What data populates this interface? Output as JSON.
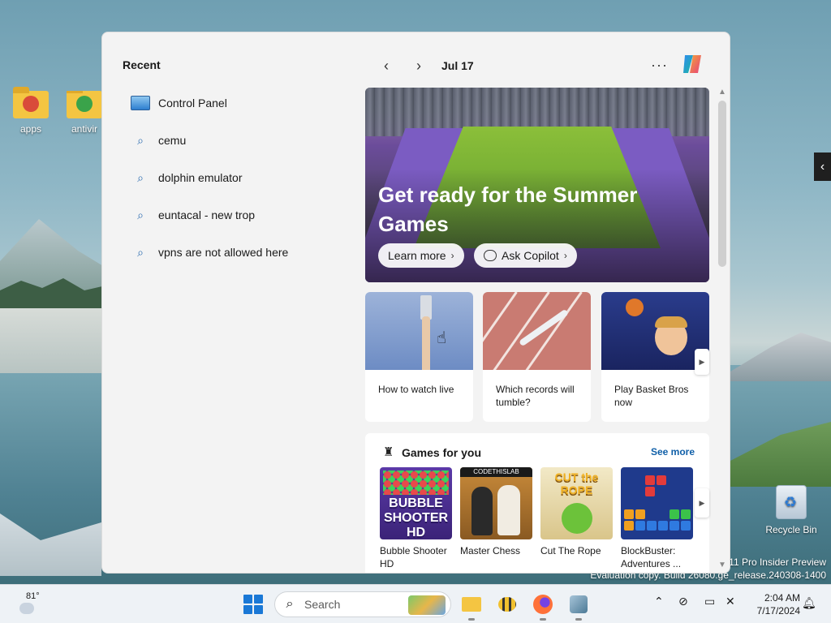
{
  "desktop": {
    "icons": [
      {
        "label": "apps"
      },
      {
        "label": "antivir"
      },
      {
        "label": "Recycle Bin"
      }
    ],
    "watermark_line1": "s 11 Pro Insider Preview",
    "watermark_line2": "Evaluation copy. Build 26080.ge_release.240308-1400"
  },
  "panel": {
    "recent_title": "Recent",
    "recent_items": [
      {
        "label": "Control Panel",
        "icon": "control-panel-icon"
      },
      {
        "label": "cemu",
        "icon": "search-icon"
      },
      {
        "label": "dolphin emulator",
        "icon": "search-icon"
      },
      {
        "label": "euntacal - new trop",
        "icon": "search-icon"
      },
      {
        "label": "vpns are not allowed here",
        "icon": "search-icon"
      }
    ],
    "nav": {
      "prev": "‹",
      "next": "›",
      "date": "Jul 17",
      "more": "···"
    },
    "hero": {
      "title": "Get ready for the Summer Games",
      "learn_more": "Learn more",
      "ask_copilot": "Ask Copilot"
    },
    "cards": [
      {
        "title": "How to watch live"
      },
      {
        "title": "Which records will tumble?"
      },
      {
        "title": "Play Basket Bros now"
      }
    ],
    "games": {
      "title": "Games for you",
      "see_more": "See more",
      "items": [
        {
          "name": "Bubble Shooter HD",
          "art_text": "BUBBLE SHOOTER HD"
        },
        {
          "name": "Master Chess",
          "art_text": "CODETHISLAB"
        },
        {
          "name": "Cut The Rope",
          "art_text": "CUT the ROPE"
        },
        {
          "name": "BlockBuster: Adventures ..."
        }
      ]
    }
  },
  "taskbar": {
    "weather_temp": "81°",
    "search_placeholder": "Search",
    "clock_time": "2:04 AM",
    "clock_date": "7/17/2024"
  },
  "colors": {
    "accent": "#1a78d6",
    "link": "#0f5fa8",
    "panel_bg": "#f3f3f3"
  }
}
